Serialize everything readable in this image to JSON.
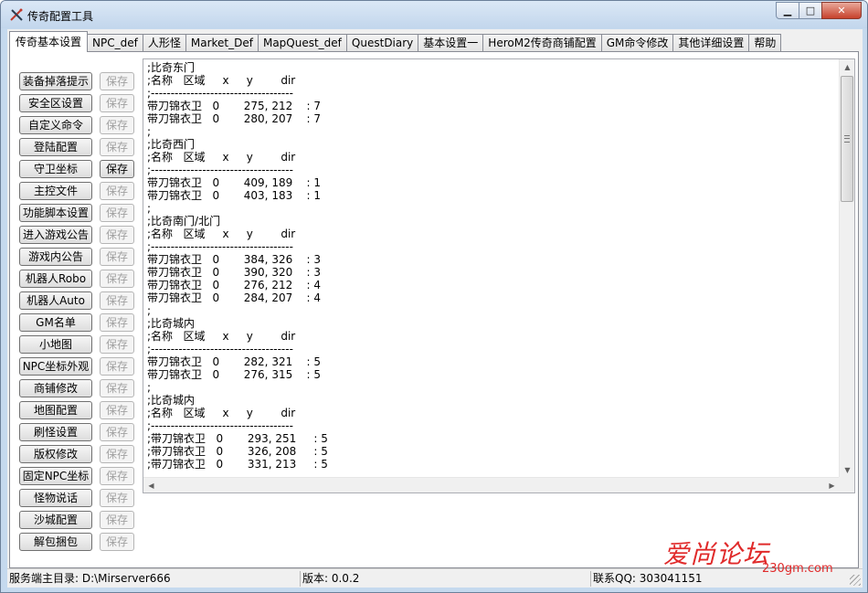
{
  "window": {
    "title": "传奇配置工具",
    "caption": {
      "minimize": "▁",
      "maximize": "□",
      "close": "✕"
    }
  },
  "tabs": [
    {
      "label": "传奇基本设置",
      "active": true
    },
    {
      "label": "NPC_def"
    },
    {
      "label": "人形怪"
    },
    {
      "label": "Market_Def"
    },
    {
      "label": "MapQuest_def"
    },
    {
      "label": "QuestDiary"
    },
    {
      "label": "基本设置一"
    },
    {
      "label": "HeroM2传奇商铺配置"
    },
    {
      "label": "GM命令修改"
    },
    {
      "label": "其他详细设置"
    },
    {
      "label": "帮助"
    }
  ],
  "left_buttons": [
    {
      "label": "装备掉落提示",
      "save": "保存",
      "save_enabled": false
    },
    {
      "label": "安全区设置",
      "save": "保存",
      "save_enabled": false
    },
    {
      "label": "自定义命令",
      "save": "保存",
      "save_enabled": false
    },
    {
      "label": "登陆配置",
      "save": "保存",
      "save_enabled": false
    },
    {
      "label": "守卫坐标",
      "save": "保存",
      "save_enabled": true
    },
    {
      "label": "主控文件",
      "save": "保存",
      "save_enabled": false
    },
    {
      "label": "功能脚本设置",
      "save": "保存",
      "save_enabled": false
    },
    {
      "label": "进入游戏公告",
      "save": "保存",
      "save_enabled": false
    },
    {
      "label": "游戏内公告",
      "save": "保存",
      "save_enabled": false
    },
    {
      "label": "机器人Robo",
      "save": "保存",
      "save_enabled": false
    },
    {
      "label": "机器人Auto",
      "save": "保存",
      "save_enabled": false
    },
    {
      "label": "GM名单",
      "save": "保存",
      "save_enabled": false
    },
    {
      "label": "小地图",
      "save": "保存",
      "save_enabled": false
    },
    {
      "label": "NPC坐标外观",
      "save": "保存",
      "save_enabled": false
    },
    {
      "label": "商铺修改",
      "save": "保存",
      "save_enabled": false
    },
    {
      "label": "地图配置",
      "save": "保存",
      "save_enabled": false
    },
    {
      "label": "刷怪设置",
      "save": "保存",
      "save_enabled": false
    },
    {
      "label": "版权修改",
      "save": "保存",
      "save_enabled": false
    },
    {
      "label": "固定NPC坐标",
      "save": "保存",
      "save_enabled": false
    },
    {
      "label": "怪物说话",
      "save": "保存",
      "save_enabled": false
    },
    {
      "label": "沙城配置",
      "save": "保存",
      "save_enabled": false
    },
    {
      "label": "解包捆包",
      "save": "保存",
      "save_enabled": false
    }
  ],
  "editor": {
    "lines": [
      ";比奇东门",
      ";名称   区域     x     y        dir",
      ";------------------------------------",
      "带刀锦衣卫   0       275, 212    : 7",
      "带刀锦衣卫   0       280, 207    : 7",
      ";",
      ";比奇西门",
      ";名称   区域     x     y        dir",
      ";------------------------------------",
      "带刀锦衣卫   0       409, 189    : 1",
      "带刀锦衣卫   0       403, 183    : 1",
      ";",
      ";比奇南门/北门",
      ";名称   区域     x     y        dir",
      ";------------------------------------",
      "带刀锦衣卫   0       384, 326    : 3",
      "带刀锦衣卫   0       390, 320    : 3",
      "带刀锦衣卫   0       276, 212    : 4",
      "带刀锦衣卫   0       284, 207    : 4",
      ";",
      ";比奇城内",
      ";名称   区域     x     y        dir",
      ";------------------------------------",
      "带刀锦衣卫   0       282, 321    : 5",
      "带刀锦衣卫   0       276, 315    : 5",
      ";",
      ";比奇城内",
      ";名称   区域     x     y        dir",
      ";------------------------------------",
      ";带刀锦衣卫   0       293, 251     : 5",
      ";带刀锦衣卫   0       326, 208     : 5",
      ";带刀锦衣卫   0       331, 213     : 5"
    ]
  },
  "statusbar": {
    "server_dir": "服务端主目录: D:\\Mirserver666",
    "version": "版本: 0.0.2",
    "contact": "联系QQ: 303041151"
  },
  "watermark": {
    "text": "爱尚论坛",
    "url": "230gm.com"
  },
  "colors": {
    "watermark": "#e02a2a",
    "window_frame": "#c5d9ee"
  }
}
